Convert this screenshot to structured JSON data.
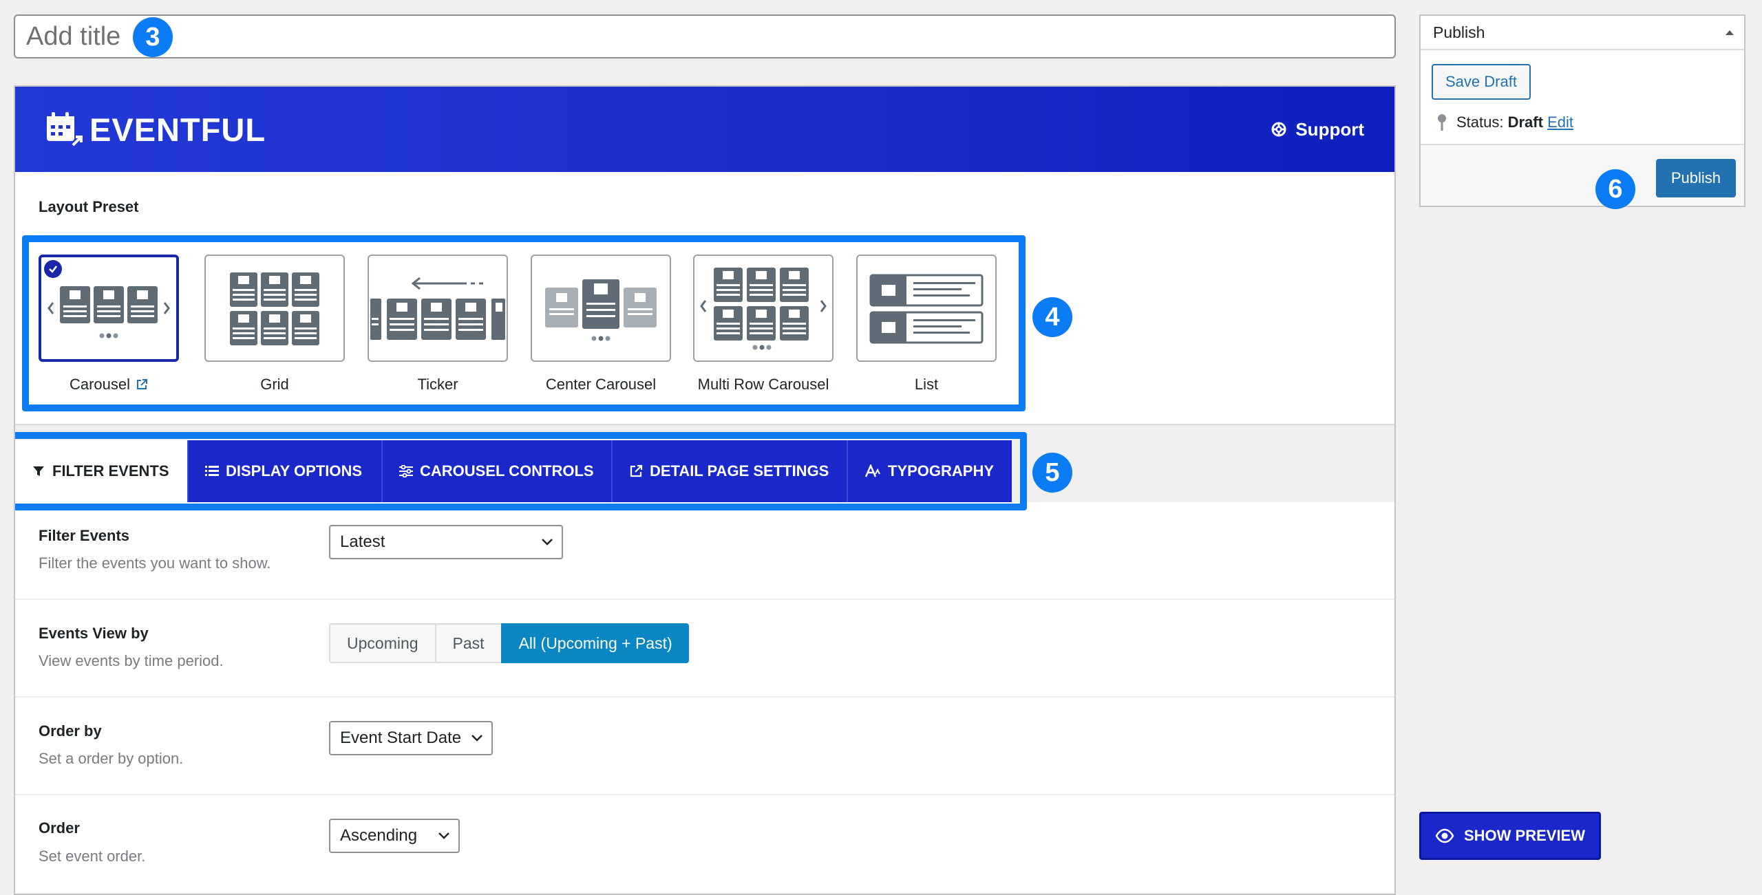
{
  "title_input": {
    "placeholder": "Add title"
  },
  "markers": {
    "m3": "3",
    "m4": "4",
    "m5": "5",
    "m6": "6"
  },
  "banner": {
    "brand": "EVENTFUL",
    "support": "Support"
  },
  "layout_preset": {
    "label": "Layout Preset",
    "presets": [
      {
        "name": "Carousel",
        "selected": true
      },
      {
        "name": "Grid",
        "selected": false
      },
      {
        "name": "Ticker",
        "selected": false
      },
      {
        "name": "Center Carousel",
        "selected": false
      },
      {
        "name": "Multi Row Carousel",
        "selected": false
      },
      {
        "name": "List",
        "selected": false
      }
    ]
  },
  "tabs": [
    {
      "label": "FILTER EVENTS",
      "active": true,
      "icon": "funnel-icon"
    },
    {
      "label": "DISPLAY OPTIONS",
      "active": false,
      "icon": "list-icon"
    },
    {
      "label": "CAROUSEL CONTROLS",
      "active": false,
      "icon": "sliders-icon"
    },
    {
      "label": "DETAIL PAGE SETTINGS",
      "active": false,
      "icon": "external-link-icon"
    },
    {
      "label": "TYPOGRAPHY",
      "active": false,
      "icon": "typography-icon"
    }
  ],
  "settings": {
    "filter_events": {
      "title": "Filter Events",
      "desc": "Filter the events you want to show.",
      "value": "Latest"
    },
    "events_view": {
      "title": "Events View by",
      "desc": "View events by time period.",
      "options": [
        "Upcoming",
        "Past",
        "All (Upcoming + Past)"
      ],
      "selected": "All (Upcoming + Past)"
    },
    "order_by": {
      "title": "Order by",
      "desc": "Set a order by option.",
      "value": "Event Start Date"
    },
    "order": {
      "title": "Order",
      "desc": "Set event order.",
      "value": "Ascending"
    }
  },
  "publish_box": {
    "title": "Publish",
    "save_draft": "Save Draft",
    "status_label": "Status:",
    "status_value": "Draft",
    "edit": "Edit",
    "publish": "Publish"
  },
  "show_preview": "SHOW PREVIEW",
  "colors": {
    "brand_blue": "#1a27c9",
    "marker_blue": "#0b7cf3",
    "wp_blue": "#2271b1",
    "segment_active": "#0a86c2"
  }
}
